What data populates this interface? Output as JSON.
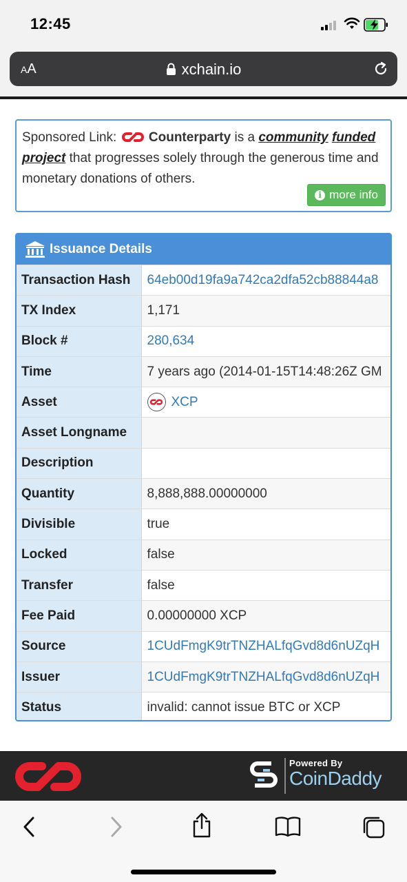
{
  "status": {
    "time": "12:45"
  },
  "browser": {
    "aa_label": "AA",
    "url": "xchain.io"
  },
  "sponsor": {
    "prefix": "Sponsored Link:",
    "brand": "Counterparty",
    "is_a": "is a",
    "link1": "community",
    "link2": "funded project",
    "suffix": "that progresses solely through the generous time and monetary donations of others.",
    "more_info": "more info"
  },
  "panel": {
    "title": "Issuance Details",
    "rows": [
      {
        "label": "Transaction Hash",
        "value": "64eb00d19fa9a742ca2dfa52cb88844a8",
        "link": true
      },
      {
        "label": "TX Index",
        "value": "1,171",
        "link": false
      },
      {
        "label": "Block #",
        "value": "280,634",
        "link": true
      },
      {
        "label": "Time",
        "value": "7 years ago (2014-01-15T14:48:26Z GM",
        "link": false
      },
      {
        "label": "Asset",
        "value": "XCP",
        "link": true
      },
      {
        "label": "Asset Longname",
        "value": "",
        "link": false
      },
      {
        "label": "Description",
        "value": "",
        "link": false
      },
      {
        "label": "Quantity",
        "value": "8,888,888.00000000",
        "link": false
      },
      {
        "label": "Divisible",
        "value": "true",
        "link": false
      },
      {
        "label": "Locked",
        "value": "false",
        "link": false
      },
      {
        "label": "Transfer",
        "value": "false",
        "link": false
      },
      {
        "label": "Fee Paid",
        "value": "0.00000000 XCP",
        "link": false
      },
      {
        "label": "Source",
        "value": "1CUdFmgK9trTNZHALfqGvd8d6nUZqH",
        "link": true
      },
      {
        "label": "Issuer",
        "value": "1CUdFmgK9trTNZHALfqGvd8d6nUZqH",
        "link": true
      },
      {
        "label": "Status",
        "value": "invalid: cannot issue BTC or XCP",
        "link": false
      }
    ]
  },
  "footer": {
    "powered_by": "Powered By",
    "coindaddy": "CoinDaddy"
  },
  "colors": {
    "accent": "#4a90d9",
    "label_bg": "#daeaf7",
    "link": "#337ab7",
    "brand_red": "#e3212f",
    "button_green": "#5cb85c"
  }
}
